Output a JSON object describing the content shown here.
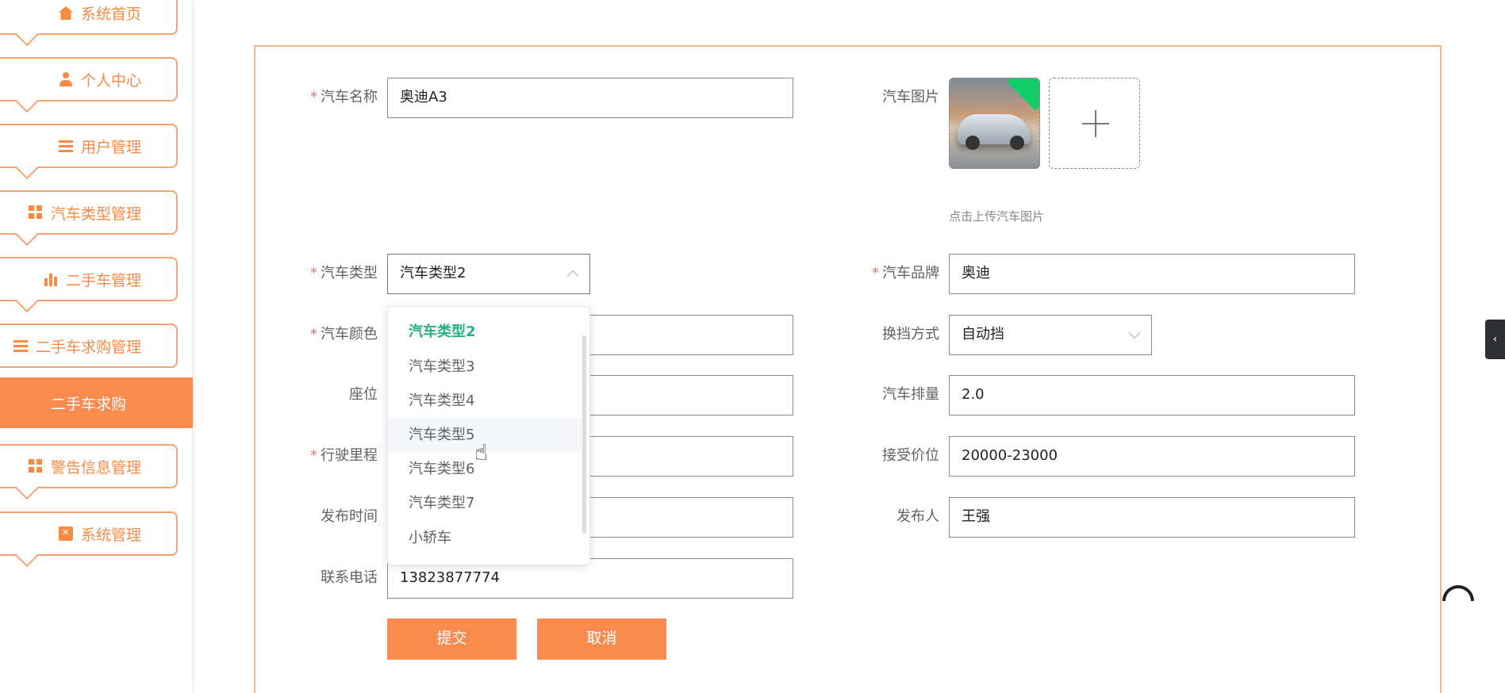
{
  "sidebar": {
    "items": [
      {
        "label": "系统首页",
        "icon": "home-icon"
      },
      {
        "label": "个人中心",
        "icon": "user-icon"
      },
      {
        "label": "用户管理",
        "icon": "list-icon"
      },
      {
        "label": "汽车类型管理",
        "icon": "grid-icon"
      },
      {
        "label": "二手车管理",
        "icon": "bar-chart-icon"
      },
      {
        "label": "二手车求购管理",
        "icon": "list-icon"
      },
      {
        "label": "警告信息管理",
        "icon": "grid-icon"
      },
      {
        "label": "系统管理",
        "icon": "clipboard-icon"
      }
    ],
    "active_sub": "二手车求购"
  },
  "form": {
    "car_name": {
      "label": "汽车名称",
      "value": "奥迪A3",
      "required": true
    },
    "car_image": {
      "label": "汽车图片",
      "tip": "点击上传汽车图片"
    },
    "car_type": {
      "label": "汽车类型",
      "value": "汽车类型2",
      "required": true
    },
    "car_brand": {
      "label": "汽车品牌",
      "value": "奥迪",
      "required": true
    },
    "car_color": {
      "label": "汽车颜色",
      "value": "",
      "required": true
    },
    "gearbox": {
      "label": "换挡方式",
      "value": "自动挡"
    },
    "seats": {
      "label": "座位",
      "value": ""
    },
    "displacement": {
      "label": "汽车排量",
      "value": "2.0"
    },
    "mileage": {
      "label": "行驶里程",
      "value": "",
      "required": true
    },
    "price": {
      "label": "接受价位",
      "value": "20000-23000"
    },
    "publish_time": {
      "label": "发布时间",
      "value": ""
    },
    "publisher": {
      "label": "发布人",
      "value": "王强"
    },
    "phone": {
      "label": "联系电话",
      "value": "13823877774"
    }
  },
  "dropdown": {
    "options": [
      "汽车类型2",
      "汽车类型3",
      "汽车类型4",
      "汽车类型5",
      "汽车类型6",
      "汽车类型7",
      "小轿车"
    ],
    "selected": "汽车类型2",
    "hovered": "汽车类型5"
  },
  "buttons": {
    "submit": "提交",
    "cancel": "取消"
  },
  "colors": {
    "accent": "#fa8b4f",
    "selected_option": "#26b17f",
    "required": "#f56c6c"
  }
}
